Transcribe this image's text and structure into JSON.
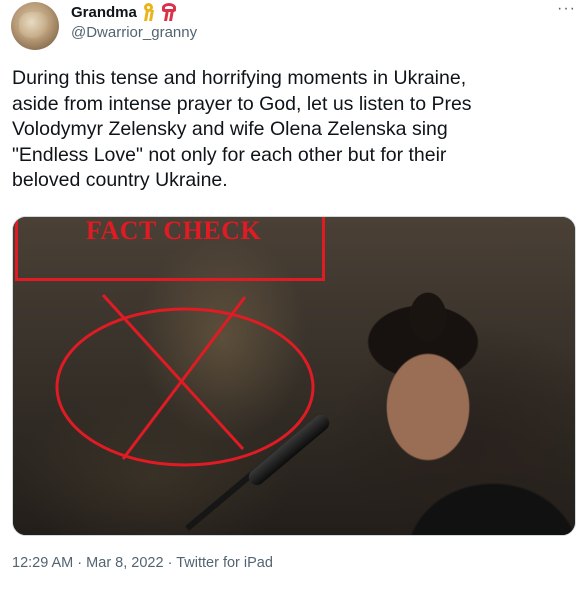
{
  "author": {
    "display_name": "Grandma",
    "handle": "@Dwarrior_granny",
    "badges": [
      "yellow-ribbon-icon",
      "red-ribbon-icon"
    ]
  },
  "tweet": {
    "lines": [
      "During this tense and horrifying moments in Ukraine,",
      "aside from intense prayer to God, let us listen to Pres",
      "Volodymyr Zelensky and wife Olena Zelenska sing",
      "\"Endless Love\" not only for each other but for their",
      "beloved country Ukraine."
    ]
  },
  "media": {
    "overlay_label": "FACT CHECK",
    "overlay_color": "#e01b24"
  },
  "footer": {
    "time": "12:29 AM",
    "sep1": "·",
    "date": "Mar 8, 2022",
    "sep2": "·",
    "source": "Twitter for iPad"
  },
  "colors": {
    "text": "#0f1419",
    "secondary": "#536471",
    "border": "#cfd9de"
  }
}
